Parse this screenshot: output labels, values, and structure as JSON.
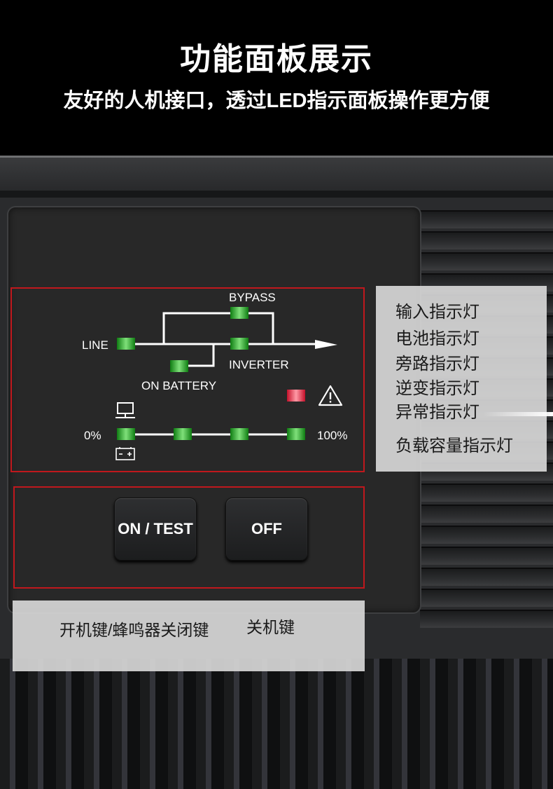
{
  "header": {
    "title": "功能面板展示",
    "subtitle": "友好的人机接口，透过LED指示面板操作更方便"
  },
  "panel": {
    "labels": {
      "bypass": "BYPASS",
      "line": "LINE",
      "inverter": "INVERTER",
      "on_battery": "ON BATTERY",
      "load_min": "0%",
      "load_max": "100%"
    },
    "icons": [
      "warning-icon",
      "computer-icon",
      "battery-icon"
    ],
    "colors": {
      "led_green": "#2fb52f",
      "led_red": "#e8203a",
      "highlight_border": "#c0181d"
    },
    "buttons": {
      "on_test": "ON / TEST",
      "off": "OFF"
    }
  },
  "annotations": {
    "indicators": [
      "输入指示灯",
      "电池指示灯",
      "旁路指示灯",
      "逆变指示灯",
      "异常指示灯",
      "负载容量指示灯"
    ],
    "buttons": {
      "on_key": "开机键/蜂鸣器关闭键",
      "off_key": "关机键"
    }
  }
}
